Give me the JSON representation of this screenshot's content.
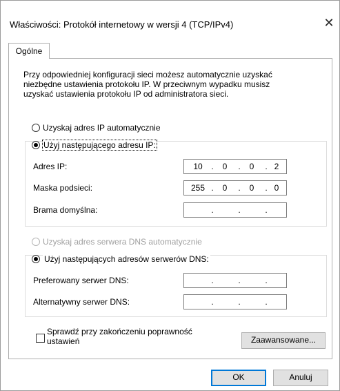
{
  "window": {
    "title": "Właściwości: Protokół internetowy w wersji 4 (TCP/IPv4)",
    "close_glyph": "✕"
  },
  "tabs": [
    {
      "label": "Ogólne"
    }
  ],
  "description": "Przy odpowiedniej konfiguracji sieci możesz automatycznie uzyskać\nniezbędne ustawienia protokołu IP. W przeciwnym wypadku musisz\nuzyskać ustawienia protokołu IP od administratora sieci.",
  "ip_section": {
    "auto_label": "Uzyskaj adres IP automatycznie",
    "auto_checked": false,
    "manual_label": "Użyj następującego adresu IP:",
    "manual_checked": true,
    "fields": [
      {
        "label": "Adres IP:",
        "octets": [
          "10",
          "0",
          "0",
          "2"
        ]
      },
      {
        "label": "Maska podsieci:",
        "octets": [
          "255",
          "0",
          "0",
          "0"
        ]
      },
      {
        "label": "Brama domyślna:",
        "octets": [
          "",
          "",
          "",
          ""
        ]
      }
    ]
  },
  "dns_section": {
    "auto_label": "Uzyskaj adres serwera DNS automatycznie",
    "auto_enabled": false,
    "manual_label": "Użyj następujących adresów serwerów DNS:",
    "manual_checked": true,
    "fields": [
      {
        "label": "Preferowany serwer DNS:",
        "octets": [
          "",
          "",
          "",
          ""
        ]
      },
      {
        "label": "Alternatywny serwer DNS:",
        "octets": [
          "",
          "",
          "",
          ""
        ]
      }
    ]
  },
  "validate": {
    "label": "Sprawdź przy zakończeniu poprawność\nustawień",
    "checked": false
  },
  "buttons": {
    "advanced": "Zaawansowane...",
    "ok": "OK",
    "cancel": "Anuluj"
  },
  "ip_dot": "."
}
